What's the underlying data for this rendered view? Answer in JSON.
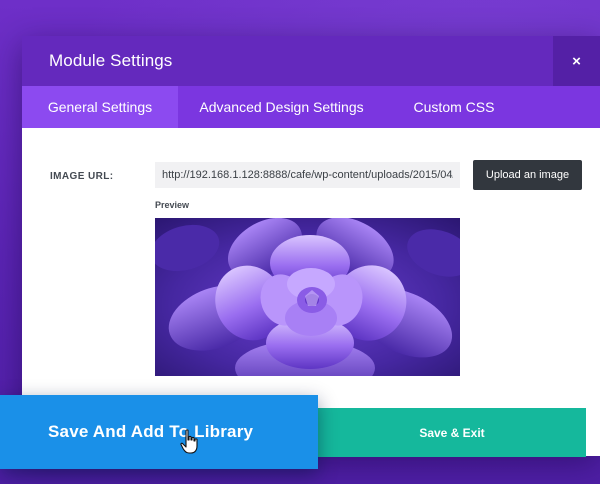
{
  "modal": {
    "title": "Module Settings",
    "close_label": "×"
  },
  "tabs": [
    {
      "label": "General Settings",
      "active": true
    },
    {
      "label": "Advanced Design Settings",
      "active": false
    },
    {
      "label": "Custom CSS",
      "active": false
    }
  ],
  "image_url_field": {
    "label": "IMAGE URL:",
    "value": "http://192.168.1.128:8888/cafe/wp-content/uploads/2015/04/",
    "upload_button_label": "Upload an image"
  },
  "preview": {
    "label": "Preview"
  },
  "footer": {
    "save_library_label": "Save And Add To Library",
    "save_exit_label": "Save & Exit"
  },
  "colors": {
    "header": "#6429bd",
    "tab_bar": "#7b36e0",
    "tab_active": "#8c4af0",
    "save_library": "#1a90e8",
    "save_exit": "#15b89c",
    "upload_button": "#32373e"
  },
  "icons": {
    "close": "close-icon",
    "cursor": "hand-pointer-cursor-icon"
  }
}
